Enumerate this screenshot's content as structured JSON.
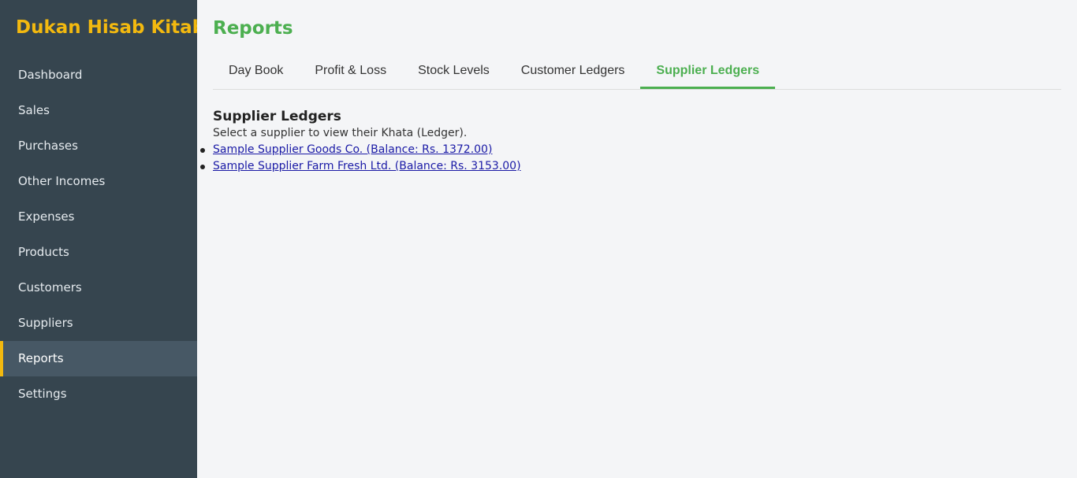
{
  "app": {
    "brand": "Dukan Hisab Kitab"
  },
  "sidebar": {
    "items": [
      {
        "label": "Dashboard"
      },
      {
        "label": "Sales"
      },
      {
        "label": "Purchases"
      },
      {
        "label": "Other Incomes"
      },
      {
        "label": "Expenses"
      },
      {
        "label": "Products"
      },
      {
        "label": "Customers"
      },
      {
        "label": "Suppliers"
      },
      {
        "label": "Reports",
        "active": true
      },
      {
        "label": "Settings"
      }
    ]
  },
  "main": {
    "title": "Reports",
    "tabs": [
      {
        "label": "Day Book"
      },
      {
        "label": "Profit & Loss"
      },
      {
        "label": "Stock Levels"
      },
      {
        "label": "Customer Ledgers"
      },
      {
        "label": "Supplier Ledgers",
        "active": true
      }
    ],
    "section": {
      "title": "Supplier Ledgers",
      "description": "Select a supplier to view their Khata (Ledger).",
      "suppliers": [
        {
          "label": "Sample Supplier Goods Co. (Balance: Rs. 1372.00)"
        },
        {
          "label": "Sample Supplier Farm Fresh Ltd. (Balance: Rs. 3153.00)"
        }
      ]
    }
  },
  "colors": {
    "sidebar_bg": "#36454f",
    "sidebar_active_bg": "#475865",
    "brand": "#f3b90f",
    "accent": "#4caf50",
    "link": "#1a1aa6"
  }
}
